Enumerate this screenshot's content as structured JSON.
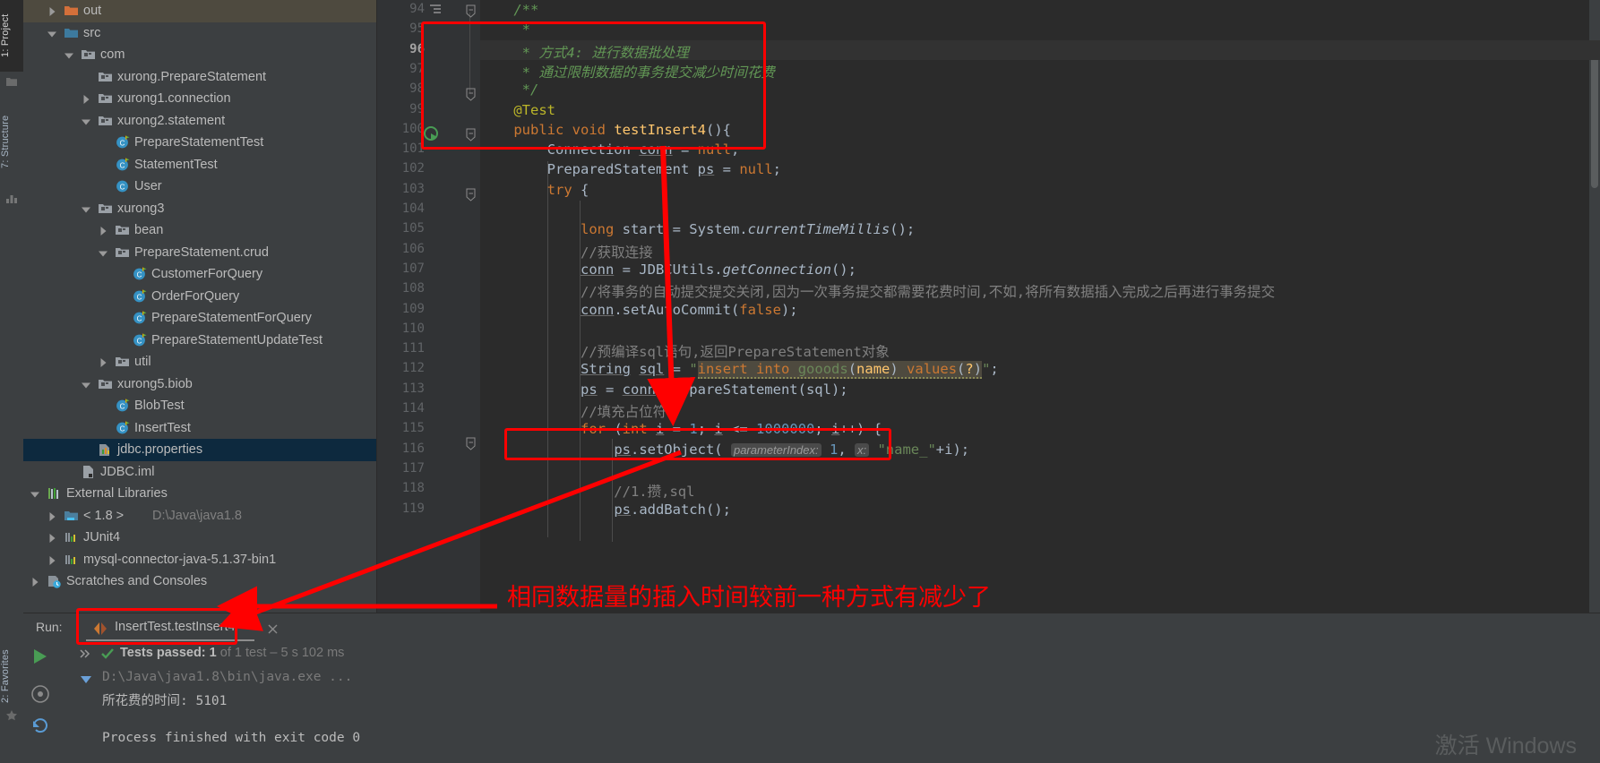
{
  "window": {
    "bg": "#3c3f41",
    "editor_bg": "#2b2b2b",
    "accent_red": "#ff0000"
  },
  "toolstrip": {
    "tabs": [
      {
        "label": "1: Project",
        "selected": true
      },
      {
        "label": "7: Structure",
        "selected": false
      },
      {
        "label": "2: Favorites",
        "selected": false
      }
    ]
  },
  "project_tree": {
    "items": [
      {
        "label": "out",
        "indent": 1,
        "arrow": "right",
        "icon": "folder-orange",
        "highlight": true
      },
      {
        "label": "src",
        "indent": 1,
        "arrow": "down",
        "icon": "folder-blue"
      },
      {
        "label": "com",
        "indent": 2,
        "arrow": "down",
        "icon": "package"
      },
      {
        "label": "xurong.PrepareStatement",
        "indent": 3,
        "arrow": "none",
        "icon": "package"
      },
      {
        "label": "xurong1.connection",
        "indent": 3,
        "arrow": "right",
        "icon": "package"
      },
      {
        "label": "xurong2.statement",
        "indent": 3,
        "arrow": "down",
        "icon": "package"
      },
      {
        "label": "PrepareStatementTest",
        "indent": 4,
        "arrow": "none",
        "icon": "class-test"
      },
      {
        "label": "StatementTest",
        "indent": 4,
        "arrow": "none",
        "icon": "class-test"
      },
      {
        "label": "User",
        "indent": 4,
        "arrow": "none",
        "icon": "class"
      },
      {
        "label": "xurong3",
        "indent": 3,
        "arrow": "down",
        "icon": "package"
      },
      {
        "label": "bean",
        "indent": 4,
        "arrow": "right",
        "icon": "package"
      },
      {
        "label": "PrepareStatement.crud",
        "indent": 4,
        "arrow": "down",
        "icon": "package"
      },
      {
        "label": "CustomerForQuery",
        "indent": 5,
        "arrow": "none",
        "icon": "class-test"
      },
      {
        "label": "OrderForQuery",
        "indent": 5,
        "arrow": "none",
        "icon": "class-test"
      },
      {
        "label": "PrepareStatementForQuery",
        "indent": 5,
        "arrow": "none",
        "icon": "class-test"
      },
      {
        "label": "PrepareStatementUpdateTest",
        "indent": 5,
        "arrow": "none",
        "icon": "class-test"
      },
      {
        "label": "util",
        "indent": 4,
        "arrow": "right",
        "icon": "package"
      },
      {
        "label": "xurong5.biob",
        "indent": 3,
        "arrow": "down",
        "icon": "package"
      },
      {
        "label": "BlobTest",
        "indent": 4,
        "arrow": "none",
        "icon": "class-test"
      },
      {
        "label": "InsertTest",
        "indent": 4,
        "arrow": "none",
        "icon": "class-test"
      },
      {
        "label": "jdbc.properties",
        "indent": 3,
        "arrow": "none",
        "icon": "properties",
        "selected": true
      },
      {
        "label": "JDBC.iml",
        "indent": 2,
        "arrow": "none",
        "icon": "iml"
      },
      {
        "label": "External Libraries",
        "indent": 0,
        "arrow": "down",
        "icon": "libraries"
      },
      {
        "label": "< 1.8 >",
        "indent": 1,
        "arrow": "right",
        "icon": "jdk",
        "suffix": "D:\\Java\\java1.8"
      },
      {
        "label": "JUnit4",
        "indent": 1,
        "arrow": "right",
        "icon": "library"
      },
      {
        "label": "mysql-connector-java-5.1.37-bin1",
        "indent": 1,
        "arrow": "right",
        "icon": "library"
      },
      {
        "label": "Scratches and Consoles",
        "indent": 0,
        "arrow": "right",
        "icon": "scratches"
      }
    ]
  },
  "editor": {
    "current_line": 96,
    "lines": [
      {
        "n": 94,
        "text": "    /**"
      },
      {
        "n": 95,
        "text": "     *"
      },
      {
        "n": 96,
        "text": "     * 方式4: 进行数据批处理"
      },
      {
        "n": 97,
        "text": "     * 通过限制数据的事务提交减少时间花费"
      },
      {
        "n": 98,
        "text": "     */"
      },
      {
        "n": 99,
        "text": "    @Test"
      },
      {
        "n": 100,
        "text": "    public void testInsert4(){"
      },
      {
        "n": 101,
        "text": "        Connection conn = null;"
      },
      {
        "n": 102,
        "text": "        PreparedStatement ps = null;"
      },
      {
        "n": 103,
        "text": "        try {"
      },
      {
        "n": 104,
        "text": ""
      },
      {
        "n": 105,
        "text": "            long start = System.currentTimeMillis();"
      },
      {
        "n": 106,
        "text": "            //获取连接"
      },
      {
        "n": 107,
        "text": "            conn = JDBCUtils.getConnection();"
      },
      {
        "n": 108,
        "text": "            //将事务的自动提交提交关闭,因为一次事务提交都需要花费时间,不如,将所有数据插入完成之后再进行事务提交"
      },
      {
        "n": 109,
        "text": "            conn.setAutoCommit(false);"
      },
      {
        "n": 110,
        "text": ""
      },
      {
        "n": 111,
        "text": "            //预编译sql语句,返回PrepareStatement对象"
      },
      {
        "n": 112,
        "text": "            String sql = \"insert into gooods(name) values(?)\";"
      },
      {
        "n": 113,
        "text": "            ps = conn.prepareStatement(sql);"
      },
      {
        "n": 114,
        "text": "            //填充占位符"
      },
      {
        "n": 115,
        "text": "            for (int i = 1; i <= 1000000; i++) {"
      },
      {
        "n": 116,
        "text": "                ps.setObject( parameterIndex: 1, x: \"name_\"+i);"
      },
      {
        "n": 117,
        "text": ""
      },
      {
        "n": 118,
        "text": "                //1.攒,sql"
      },
      {
        "n": 119,
        "text": "                ps.addBatch();"
      }
    ],
    "hints": {
      "param_index": "parameterIndex:",
      "param_x": "x:"
    }
  },
  "run_panel": {
    "label": "Run:",
    "tab_title": "InsertTest.testInsert4",
    "status_bold": "Tests passed: 1",
    "status_dim": "of 1 test – 5 s 102 ms",
    "console_command": "D:\\Java\\java1.8\\bin\\java.exe ...",
    "console_output": "所花费的时间: 5101",
    "console_exit": "Process finished with exit code 0"
  },
  "annotations": {
    "note_text": "相同数据量的插入时间较前一种方式有减少了",
    "color": "#ff0000"
  },
  "watermark": "激活 Windows"
}
